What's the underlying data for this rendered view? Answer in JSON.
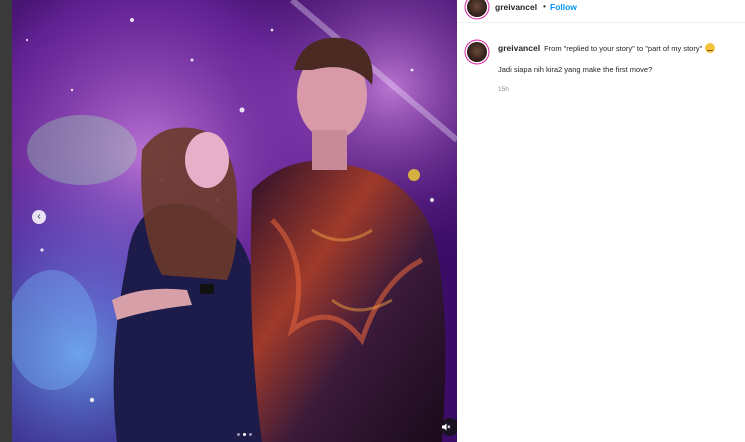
{
  "header": {
    "username": "greivancel",
    "separator": "•",
    "follow_label": "Follow"
  },
  "caption": {
    "username": "greivancel",
    "text": "From \"replied to your story\" to \"part of my story\"",
    "emoji": "smiling-face-with-tear",
    "body": "Jadi siapa nih kira2 yang make the first move?",
    "timestamp": "15h"
  },
  "media": {
    "carousel_prev_icon": "chevron-left-icon",
    "mute_icon": "speaker-muted-icon",
    "carousel_dots": 3,
    "active_dot": 1
  },
  "colors": {
    "follow": "#0095f6",
    "story_ring": "#d6249f",
    "text": "#262626",
    "muted_text": "#8e8e8e"
  }
}
